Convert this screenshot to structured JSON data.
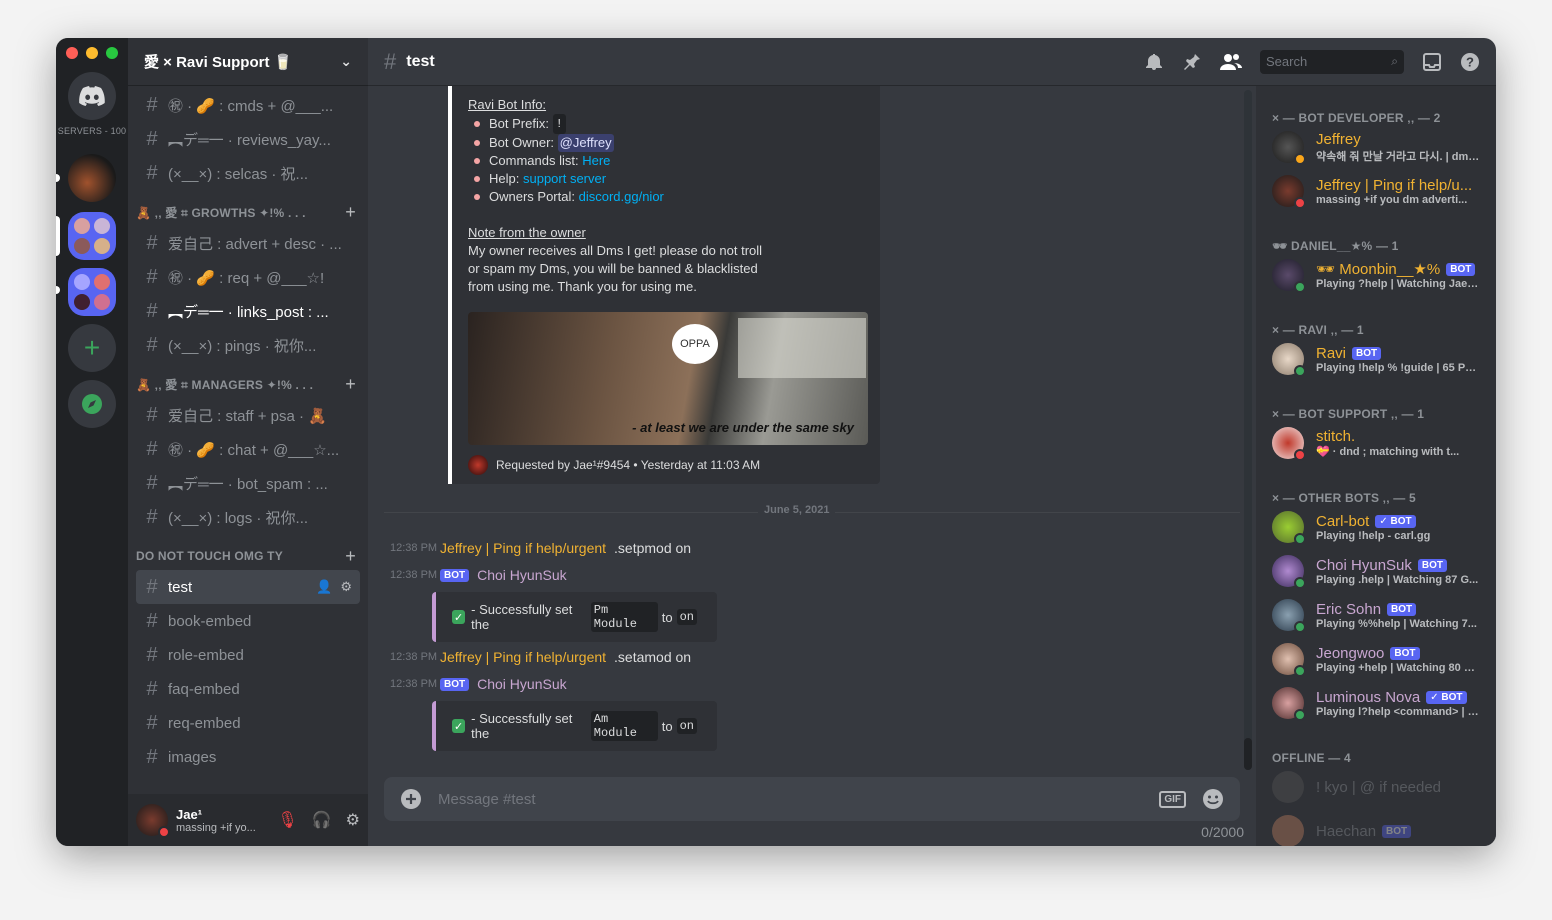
{
  "rail": {
    "servers_label": "SERVERS - 100"
  },
  "guild": {
    "name": "愛 × Ravi Support 🥛"
  },
  "channels": {
    "top": [
      {
        "name": "㊗ · 🥜 : cmds + @___..."
      },
      {
        "name": "︻デ═一 · reviews_yay..."
      },
      {
        "name": "(×__×) : selcas · 祝..."
      }
    ],
    "cat1": "🧸 ‚‚ 愛 ⌗ GROWTHS ✦!% . . .",
    "group1": [
      {
        "name": "爱自己 : advert + desc · ..."
      },
      {
        "name": "㊗ · 🥜 : req + @___☆!"
      },
      {
        "name": "︻デ═一 · links_post : ..."
      },
      {
        "name": "(×__×) : pings · 祝你..."
      }
    ],
    "cat2": "🧸 ‚‚ 愛 ⌗ MANAGERS ✦!% . . .",
    "group2": [
      {
        "name": "爱自己 : staff + psa · 🧸"
      },
      {
        "name": "㊗ · 🥜 : chat + @___☆..."
      },
      {
        "name": "︻デ═一 · bot_spam : ..."
      },
      {
        "name": "(×__×) : logs · 祝你..."
      }
    ],
    "cat3": "DO NOT TOUCH OMG TY",
    "group3": [
      {
        "name": "test"
      },
      {
        "name": "book-embed"
      },
      {
        "name": "role-embed"
      },
      {
        "name": "faq-embed"
      },
      {
        "name": "req-embed"
      },
      {
        "name": "images"
      }
    ]
  },
  "user": {
    "name": "Jae¹",
    "status": "massing +if yo..."
  },
  "topbar": {
    "channel": "test",
    "search_placeholder": "Search"
  },
  "embed": {
    "info_title": "Ravi Bot Info:",
    "prefix_label": "Bot Prefix:",
    "prefix_value": "!",
    "owner_label": "Bot Owner:",
    "owner_value": "@Jeffrey",
    "commands_label": "Commands list:",
    "commands_value": "Here",
    "help_label": "Help:",
    "help_value": "support server",
    "portal_label": "Owners Portal:",
    "portal_value": "discord.gg/nior",
    "note_title": "Note from the owner",
    "note_line1": "My owner receives all Dms I get! please do not troll",
    "note_line2": "or spam my Dms, you will be banned & blacklisted",
    "note_line3": "from using me. Thank you for using me.",
    "image_caption": "at least we are under the same sky",
    "image_bubble": "OPPA",
    "footer": "Requested by Jae¹#9454 • Yesterday at 11:03 AM"
  },
  "divider_date": "June 5, 2021",
  "messages": [
    {
      "time": "12:38 PM",
      "author": "Jeffrey | Ping if help/urgent",
      "text": ".setpmod on"
    },
    {
      "time": "12:38 PM",
      "author": "Choi HyunSuk",
      "bot": "BOT"
    },
    {
      "time": "12:38 PM",
      "author": "Jeffrey | Ping if help/urgent",
      "text": ".setamod on"
    },
    {
      "time": "12:38 PM",
      "author": "Choi HyunSuk",
      "bot": "BOT"
    }
  ],
  "embed_results": [
    {
      "prefix": "- Successfully set the",
      "code": "Pm Module",
      "mid": "to",
      "code2": "on"
    },
    {
      "prefix": "- Successfully set the",
      "code": "Am Module",
      "mid": "to",
      "code2": "on"
    }
  ],
  "composer": {
    "placeholder": "Message #test",
    "gif": "GIF",
    "counter": "0/2000"
  },
  "members": {
    "groups": [
      {
        "title": "× — BOT DEVELOPER ‚‚ — 2"
      },
      {
        "title": "🕶 DANIEL__★% — 1"
      },
      {
        "title": "× — RAVI ‚‚ — 1"
      },
      {
        "title": "× — BOT SUPPORT ‚‚ — 1"
      },
      {
        "title": "× — OTHER BOTS ‚‚ — 5"
      },
      {
        "title": "OFFLINE — 4"
      }
    ],
    "list": [
      {
        "name": "Jeffrey",
        "sub": "약속해 줘 만날 거라고 다시. | dm ...",
        "color": "#f0b232"
      },
      {
        "name": "Jeffrey | Ping if help/u...",
        "sub": "massing +if you dm adverti...",
        "color": "#f0b232"
      },
      {
        "name": "🕶 Moonbin__★%",
        "sub": "Playing ?help | Watching Jae d...",
        "color": "#f0b232",
        "bot": "BOT"
      },
      {
        "name": "Ravi",
        "sub": "Playing !help % !guide | 65 Por...",
        "color": "#f0b232",
        "bot": "BOT"
      },
      {
        "name": "stitch.",
        "sub": "💝 · dnd ; matching with t...",
        "color": "#f0b232"
      },
      {
        "name": "Carl-bot",
        "sub": "Playing !help - carl.gg",
        "color": "#f0b232",
        "bot": "✓ BOT"
      },
      {
        "name": "Choi HyunSuk",
        "sub": "Playing .help | Watching 87 G...",
        "color": "#c8a6d0",
        "bot": "BOT"
      },
      {
        "name": "Eric Sohn",
        "sub": "Playing %%help | Watching 7...",
        "color": "#c8a6d0",
        "bot": "BOT"
      },
      {
        "name": "Jeongwoo",
        "sub": "Playing +help | Watching 80 G...",
        "color": "#c8a6d0",
        "bot": "BOT"
      },
      {
        "name": "Luminous Nova",
        "sub": "Playing l?help <command> | [1...",
        "color": "#c8a6d0",
        "bot": "✓ BOT"
      },
      {
        "name": "! kyo | @ if needed",
        "sub": "",
        "color": "#8e9297"
      },
      {
        "name": "Haechan",
        "sub": "",
        "color": "#8e9297",
        "bot": "BOT"
      }
    ]
  },
  "colors": {
    "accent": "#5865f2",
    "online": "#3ba55c",
    "dnd": "#ed4245",
    "author": "#f0b232",
    "bot_author": "#c8a6d0"
  }
}
